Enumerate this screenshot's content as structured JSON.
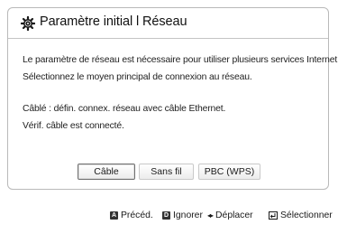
{
  "dialog": {
    "title": "Paramètre initial l Réseau",
    "line1": "Le paramètre de réseau est nécessaire pour utiliser plusieurs services Internet.",
    "line2": "Sélectionnez le moyen principal de connexion au réseau.",
    "line3": "Câblé : défin. connex. réseau avec câble Ethernet.",
    "line4": "Vérif. câble est connecté.",
    "options": [
      {
        "label": "Câble",
        "selected": true
      },
      {
        "label": "Sans fil",
        "selected": false
      },
      {
        "label": "PBC (WPS)",
        "selected": false
      }
    ]
  },
  "footer": {
    "prev_key": "A",
    "prev_label": "Précéd.",
    "skip_key": "D",
    "skip_label": "Ignorer",
    "move_label": "Déplacer",
    "select_label": "Sélectionner"
  },
  "icons": [
    "gear-icon",
    "a-key-icon",
    "d-key-icon",
    "left-right-arrows-icon",
    "enter-icon"
  ],
  "colors": {
    "background": "#ffffff",
    "border": "#b9b9b9",
    "key": "#333333"
  }
}
